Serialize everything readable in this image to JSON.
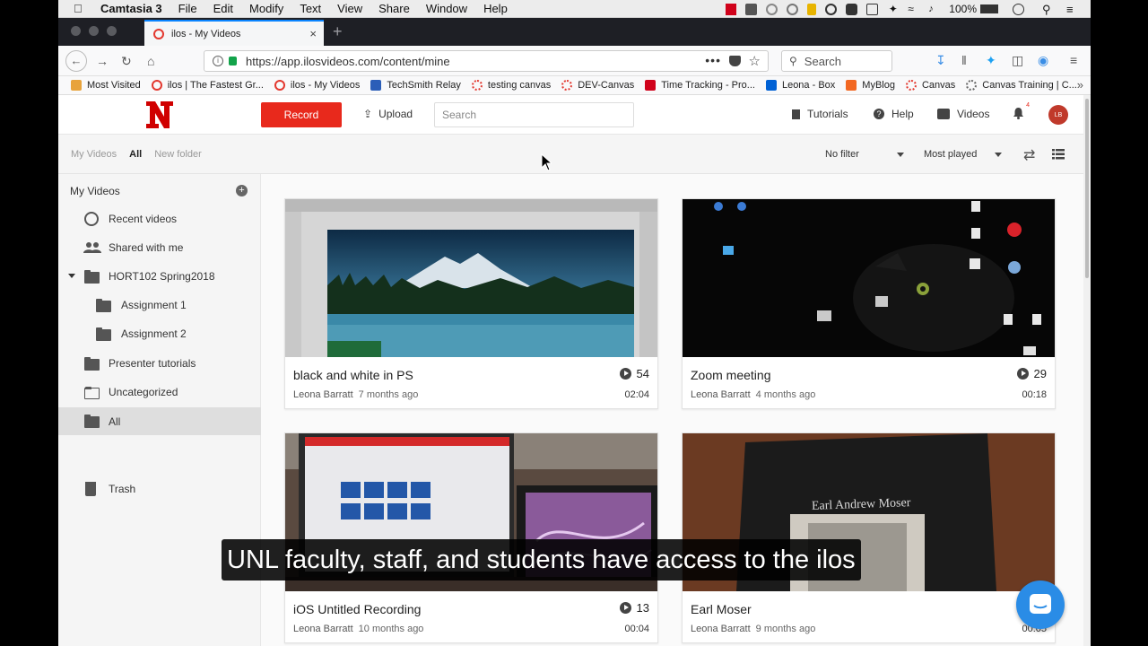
{
  "menubar": {
    "app_name": "Camtasia 3",
    "items": [
      "File",
      "Edit",
      "Modify",
      "Text",
      "View",
      "Share",
      "Window",
      "Help"
    ],
    "battery": "100%"
  },
  "browser": {
    "tab_title": "ilos - My Videos",
    "url": "https://app.ilosvideos.com/content/mine",
    "search_placeholder": "Search",
    "bookmarks": [
      {
        "label": "Most Visited",
        "color": "#e8a33b"
      },
      {
        "label": "ilos | The Fastest Gr...",
        "color": "#e3382f"
      },
      {
        "label": "ilos - My Videos",
        "color": "#e3382f"
      },
      {
        "label": "TechSmith Relay",
        "color": "#2b5eb8"
      },
      {
        "label": "testing canvas",
        "color": "#e3382f"
      },
      {
        "label": "DEV-Canvas",
        "color": "#e3382f"
      },
      {
        "label": "Time Tracking - Pro...",
        "color": "#d0021b"
      },
      {
        "label": "Leona - Box",
        "color": "#0061d5"
      },
      {
        "label": "MyBlog",
        "color": "#f26722"
      },
      {
        "label": "Canvas",
        "color": "#e3382f"
      },
      {
        "label": "Canvas Training | C...",
        "color": "#666666"
      }
    ]
  },
  "app": {
    "record_label": "Record",
    "upload_label": "Upload",
    "search_placeholder": "Search",
    "tutorials_label": "Tutorials",
    "help_label": "Help",
    "videos_label": "Videos",
    "notif_count": "4",
    "avatar_initials": "LB",
    "brand_color": "#e8291c"
  },
  "breadcrumb": [
    "My Videos",
    "All",
    "New folder"
  ],
  "filters": {
    "filter_value": "No filter",
    "sort_value": "Most played"
  },
  "sidebar": {
    "header": "My Videos",
    "items": [
      {
        "label": "Recent videos",
        "icon": "clock-icon"
      },
      {
        "label": "Shared with me",
        "icon": "people-icon"
      },
      {
        "label": "HORT102 Spring2018",
        "icon": "folder-icon"
      },
      {
        "label": "Assignment 1",
        "icon": "folder-icon"
      },
      {
        "label": "Assignment 2",
        "icon": "folder-icon"
      },
      {
        "label": "Presenter tutorials",
        "icon": "folder-icon"
      },
      {
        "label": "Uncategorized",
        "icon": "folder-open-icon"
      },
      {
        "label": "All",
        "icon": "folder-icon"
      },
      {
        "label": "Trash",
        "icon": "trash-icon"
      }
    ]
  },
  "videos": [
    {
      "title": "black and white in PS",
      "views": "54",
      "author": "Leona Barratt",
      "ago": "7 months ago",
      "duration": "02:04"
    },
    {
      "title": "Zoom meeting",
      "views": "29",
      "author": "Leona Barratt",
      "ago": "4 months ago",
      "duration": "00:18"
    },
    {
      "title": "iOS Untitled Recording",
      "views": "13",
      "author": "Leona Barratt",
      "ago": "10 months ago",
      "duration": "00:04"
    },
    {
      "title": "Earl Moser",
      "views": "",
      "author": "Leona Barratt",
      "ago": "9 months ago",
      "duration": "00:05"
    }
  ],
  "thumb_text": {
    "book_title": "Earl Andrew Moser"
  },
  "caption": "UNL faculty, staff, and students have access to the ilos"
}
